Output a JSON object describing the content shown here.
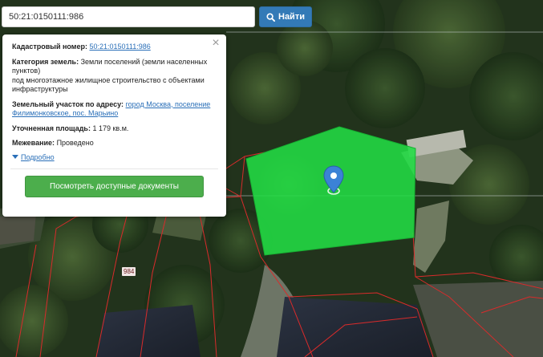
{
  "search": {
    "value": "50:21:0150111:986",
    "button_label": "Найти",
    "button_icon": "search-icon"
  },
  "popup": {
    "close_icon": "close-icon",
    "cadastral_label": "Кадастровый номер:",
    "cadastral_value": "50:21:0150111:986",
    "category_label": "Категория земель:",
    "category_value": "Земли поселений (земли населенных пунктов)",
    "category_value_2": "под многоэтажное жилищное строительство с объектами инфраструктуры",
    "address_label": "Земельный участок по адресу:",
    "address_value": "город Москва, поселение Филимонковское, пос. Марьино",
    "area_label": "Уточненная площадь:",
    "area_value": "1 179 кв.м.",
    "survey_label": "Межевание:",
    "survey_value": "Проведено",
    "more_label": "Подробно",
    "docs_button": "Посмотреть доступные документы"
  },
  "map": {
    "parcel_number": "984",
    "parcel_color": "#22dd44",
    "boundary_color": "#d92b2b",
    "marker_color": "#3b82d6",
    "marker_icon": "location-pin-icon"
  }
}
